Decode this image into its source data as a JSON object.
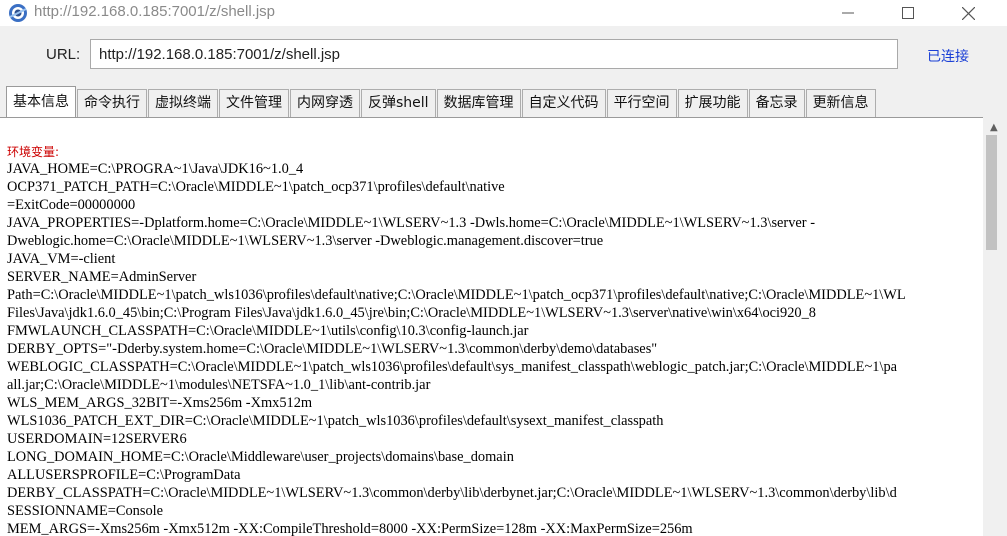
{
  "window": {
    "title": "http://192.168.0.185:7001/z/shell.jsp"
  },
  "urlbar": {
    "label": "URL:",
    "value": "http://192.168.0.185:7001/z/shell.jsp",
    "status": "已连接"
  },
  "tabs": [
    {
      "label": "基本信息",
      "active": true
    },
    {
      "label": "命令执行"
    },
    {
      "label": "虚拟终端"
    },
    {
      "label": "文件管理"
    },
    {
      "label": "内网穿透"
    },
    {
      "label": "反弹shell"
    },
    {
      "label": "数据库管理"
    },
    {
      "label": "自定义代码"
    },
    {
      "label": "平行空间"
    },
    {
      "label": "扩展功能"
    },
    {
      "label": "备忘录"
    },
    {
      "label": "更新信息"
    }
  ],
  "content": {
    "heading": "环境变量:",
    "lines": [
      "JAVA_HOME=C:\\PROGRA~1\\Java\\JDK16~1.0_4",
      "OCP371_PATCH_PATH=C:\\Oracle\\MIDDLE~1\\patch_ocp371\\profiles\\default\\native",
      "=ExitCode=00000000",
      "JAVA_PROPERTIES=-Dplatform.home=C:\\Oracle\\MIDDLE~1\\WLSERV~1.3 -Dwls.home=C:\\Oracle\\MIDDLE~1\\WLSERV~1.3\\server -",
      "Dweblogic.home=C:\\Oracle\\MIDDLE~1\\WLSERV~1.3\\server -Dweblogic.management.discover=true",
      "JAVA_VM=-client",
      "SERVER_NAME=AdminServer",
      "Path=C:\\Oracle\\MIDDLE~1\\patch_wls1036\\profiles\\default\\native;C:\\Oracle\\MIDDLE~1\\patch_ocp371\\profiles\\default\\native;C:\\Oracle\\MIDDLE~1\\WL",
      "Files\\Java\\jdk1.6.0_45\\bin;C:\\Program Files\\Java\\jdk1.6.0_45\\jre\\bin;C:\\Oracle\\MIDDLE~1\\WLSERV~1.3\\server\\native\\win\\x64\\oci920_8",
      "FMWLAUNCH_CLASSPATH=C:\\Oracle\\MIDDLE~1\\utils\\config\\10.3\\config-launch.jar",
      "DERBY_OPTS=\"-Dderby.system.home=C:\\Oracle\\MIDDLE~1\\WLSERV~1.3\\common\\derby\\demo\\databases\"",
      "WEBLOGIC_CLASSPATH=C:\\Oracle\\MIDDLE~1\\patch_wls1036\\profiles\\default\\sys_manifest_classpath\\weblogic_patch.jar;C:\\Oracle\\MIDDLE~1\\pa",
      "all.jar;C:\\Oracle\\MIDDLE~1\\modules\\NETSFA~1.0_1\\lib\\ant-contrib.jar",
      "WLS_MEM_ARGS_32BIT=-Xms256m -Xmx512m",
      "WLS1036_PATCH_EXT_DIR=C:\\Oracle\\MIDDLE~1\\patch_wls1036\\profiles\\default\\sysext_manifest_classpath",
      "USERDOMAIN=12SERVER6",
      "LONG_DOMAIN_HOME=C:\\Oracle\\Middleware\\user_projects\\domains\\base_domain",
      "ALLUSERSPROFILE=C:\\ProgramData",
      "DERBY_CLASSPATH=C:\\Oracle\\MIDDLE~1\\WLSERV~1.3\\common\\derby\\lib\\derbynet.jar;C:\\Oracle\\MIDDLE~1\\WLSERV~1.3\\common\\derby\\lib\\d",
      "SESSIONNAME=Console",
      "MEM_ARGS=-Xms256m -Xmx512m -XX:CompileThreshold=8000 -XX:PermSize=128m -XX:MaxPermSize=256m"
    ]
  }
}
